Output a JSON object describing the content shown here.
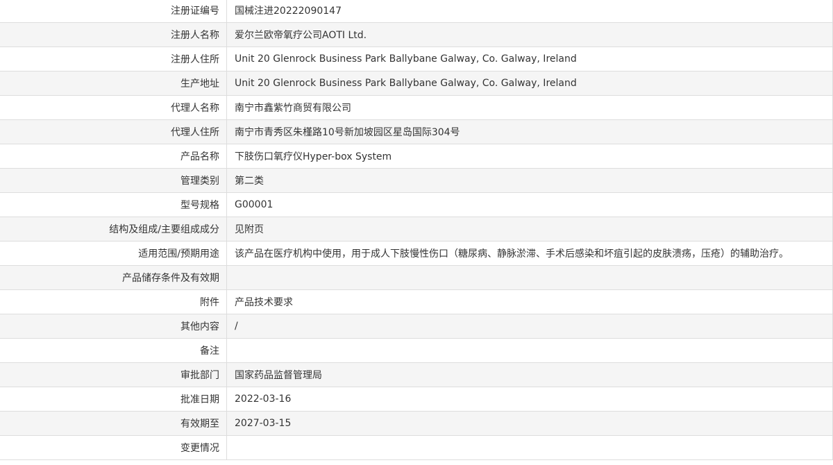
{
  "record": {
    "rows": [
      {
        "label": "注册证编号",
        "value": "国械注进20222090147"
      },
      {
        "label": "注册人名称",
        "value": "爱尔兰欧帝氧疗公司AOTI Ltd."
      },
      {
        "label": "注册人住所",
        "value": "Unit 20 Glenrock Business Park Ballybane Galway, Co. Galway, Ireland"
      },
      {
        "label": "生产地址",
        "value": "Unit 20 Glenrock Business Park Ballybane Galway, Co. Galway, Ireland"
      },
      {
        "label": "代理人名称",
        "value": "南宁市鑫紫竹商贸有限公司"
      },
      {
        "label": "代理人住所",
        "value": "南宁市青秀区朱槿路10号新加坡园区星岛国际304号"
      },
      {
        "label": "产品名称",
        "value": "下肢伤口氧疗仪Hyper-box System"
      },
      {
        "label": "管理类别",
        "value": "第二类"
      },
      {
        "label": "型号规格",
        "value": "G00001"
      },
      {
        "label": "结构及组成/主要组成成分",
        "value": "见附页"
      },
      {
        "label": "适用范围/预期用途",
        "value": "该产品在医疗机构中使用，用于成人下肢慢性伤口（糖尿病、静脉淤滞、手术后感染和坏疽引起的皮肤溃疡，压疮）的辅助治疗。"
      },
      {
        "label": "产品储存条件及有效期",
        "value": ""
      },
      {
        "label": "附件",
        "value": "产品技术要求"
      },
      {
        "label": "其他内容",
        "value": "/"
      },
      {
        "label": "备注",
        "value": ""
      },
      {
        "label": "审批部门",
        "value": "国家药品监督管理局"
      },
      {
        "label": "批准日期",
        "value": "2022-03-16"
      },
      {
        "label": "有效期至",
        "value": "2027-03-15"
      },
      {
        "label": "变更情况",
        "value": ""
      }
    ]
  }
}
